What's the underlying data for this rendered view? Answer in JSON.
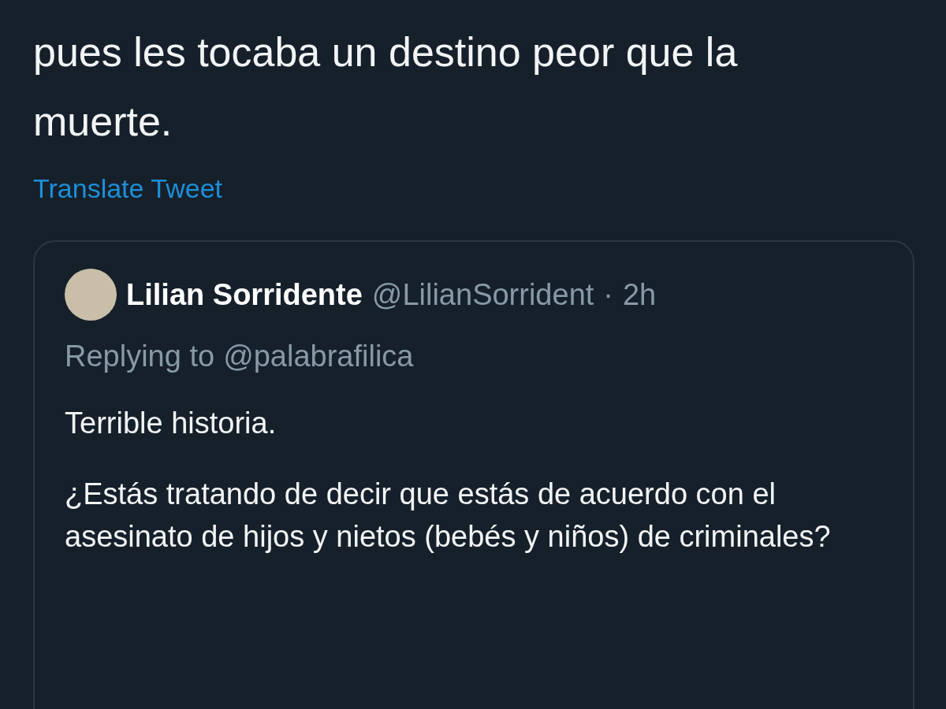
{
  "tweet": {
    "text": "pues les tocaba un destino peor que la muerte.",
    "translate_link": "Translate Tweet"
  },
  "quoted_tweet": {
    "name": "Lilian Sorridente",
    "handle": "@LilianSorrident",
    "separator": "·",
    "time": "2h",
    "replying_label": "Replying to",
    "replying_handle": "@palabrafilica",
    "paragraphs": [
      "Terrible historia.",
      "¿Estás tratando de decir que estás de acuerdo con el asesinato de hijos y nietos (bebés y niños) de criminales?"
    ]
  }
}
